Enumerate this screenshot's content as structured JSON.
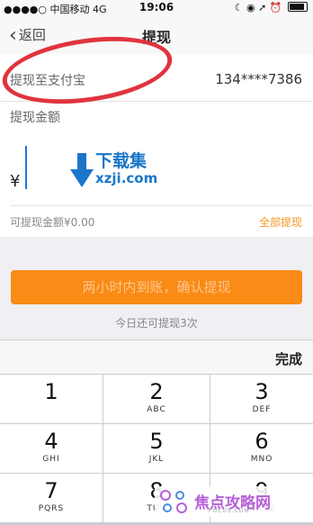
{
  "status_bar": {
    "carrier": "●●●●○ 中国移动",
    "network": "4G",
    "time": "19:06",
    "icons": "☾ ◉ ➚ ⏰"
  },
  "nav": {
    "back_label": "返回",
    "title": "提现"
  },
  "form": {
    "alipay_label": "提现至支付宝",
    "alipay_account": "134****7386",
    "amount_label": "提现金额",
    "currency_symbol": "¥",
    "available_text": "可提现金额¥0.00",
    "withdraw_all_label": "全部提现"
  },
  "confirm_button_label": "两小时内到账，确认提现",
  "remaining_text": "今日还可提现3次",
  "keyboard": {
    "done_label": "完成",
    "keys": [
      {
        "num": "1",
        "letters": ""
      },
      {
        "num": "2",
        "letters": "ABC"
      },
      {
        "num": "3",
        "letters": "DEF"
      },
      {
        "num": "4",
        "letters": "GHI"
      },
      {
        "num": "5",
        "letters": "JKL"
      },
      {
        "num": "6",
        "letters": "MNO"
      },
      {
        "num": "7",
        "letters": "PQRS"
      },
      {
        "num": "8",
        "letters": "TUV"
      },
      {
        "num": "9",
        "letters": "WXYZ"
      }
    ]
  },
  "watermarks": {
    "top_title": "下载集",
    "top_domain": "xzji.com",
    "bottom_title": "焦点攻略网",
    "bottom_sub": "FOCUS.COM"
  },
  "colors": {
    "accent_orange": "#f98b16",
    "link_orange": "#f59a23",
    "annotation_red": "#e0343e",
    "cursor_blue": "#1a73e8"
  }
}
